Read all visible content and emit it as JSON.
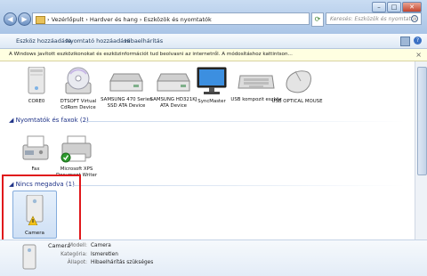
{
  "address": {
    "segments": [
      "Vezérlőpult",
      "Hardver és hang",
      "Eszközök és nyomtatók"
    ],
    "separator": "›",
    "search_placeholder": "Keresés: Eszközök és nyomtatók"
  },
  "toolbar": {
    "add_device": "Eszköz hozzáadása",
    "add_printer": "Nyomtató hozzáadása",
    "troubleshoot": "Hibaelhárítás"
  },
  "infobar": {
    "message": "A Windows javított eszközikonokat és eszközinformációt tud beolvasni az internetről. A módosításhoz kattintson..."
  },
  "devices": [
    {
      "name": "CORE0",
      "icon": "computer-icon"
    },
    {
      "name": "DTSOFT Virtual CdRom Device",
      "icon": "cdrom-icon"
    },
    {
      "name": "SAMSUNG 470 Series SSD ATA Device",
      "icon": "drive-icon"
    },
    {
      "name": "SAMSUNG HD321KJ ATA Device",
      "icon": "drive-icon"
    },
    {
      "name": "SyncMaster",
      "icon": "monitor-icon"
    },
    {
      "name": "USB kompozit eszköz",
      "icon": "keyboard-icon"
    },
    {
      "name": "USB OPTICAL MOUSE",
      "icon": "mouse-icon"
    }
  ],
  "printers_section": {
    "title": "Nyomtatók és faxok (2)",
    "items": [
      {
        "name": "Fax",
        "icon": "fax-icon"
      },
      {
        "name": "Microsoft XPS Document Writer",
        "icon": "printer-icon"
      }
    ]
  },
  "unspecified_section": {
    "title": "Nincs megadva (1)",
    "items": [
      {
        "name": "Camera",
        "icon": "camera-device-icon"
      }
    ]
  },
  "details": {
    "name": "Camera",
    "model_label": "Modell:",
    "model_value": "Camera",
    "category_label": "Kategória:",
    "category_value": "Ismeretlen",
    "status_label": "Állapot:",
    "status_value": "Hibaelhárítás szükséges"
  },
  "colors": {
    "highlight_box": "#e0181b",
    "section_header": "#1e3287",
    "selection": "#cfe0f5"
  }
}
